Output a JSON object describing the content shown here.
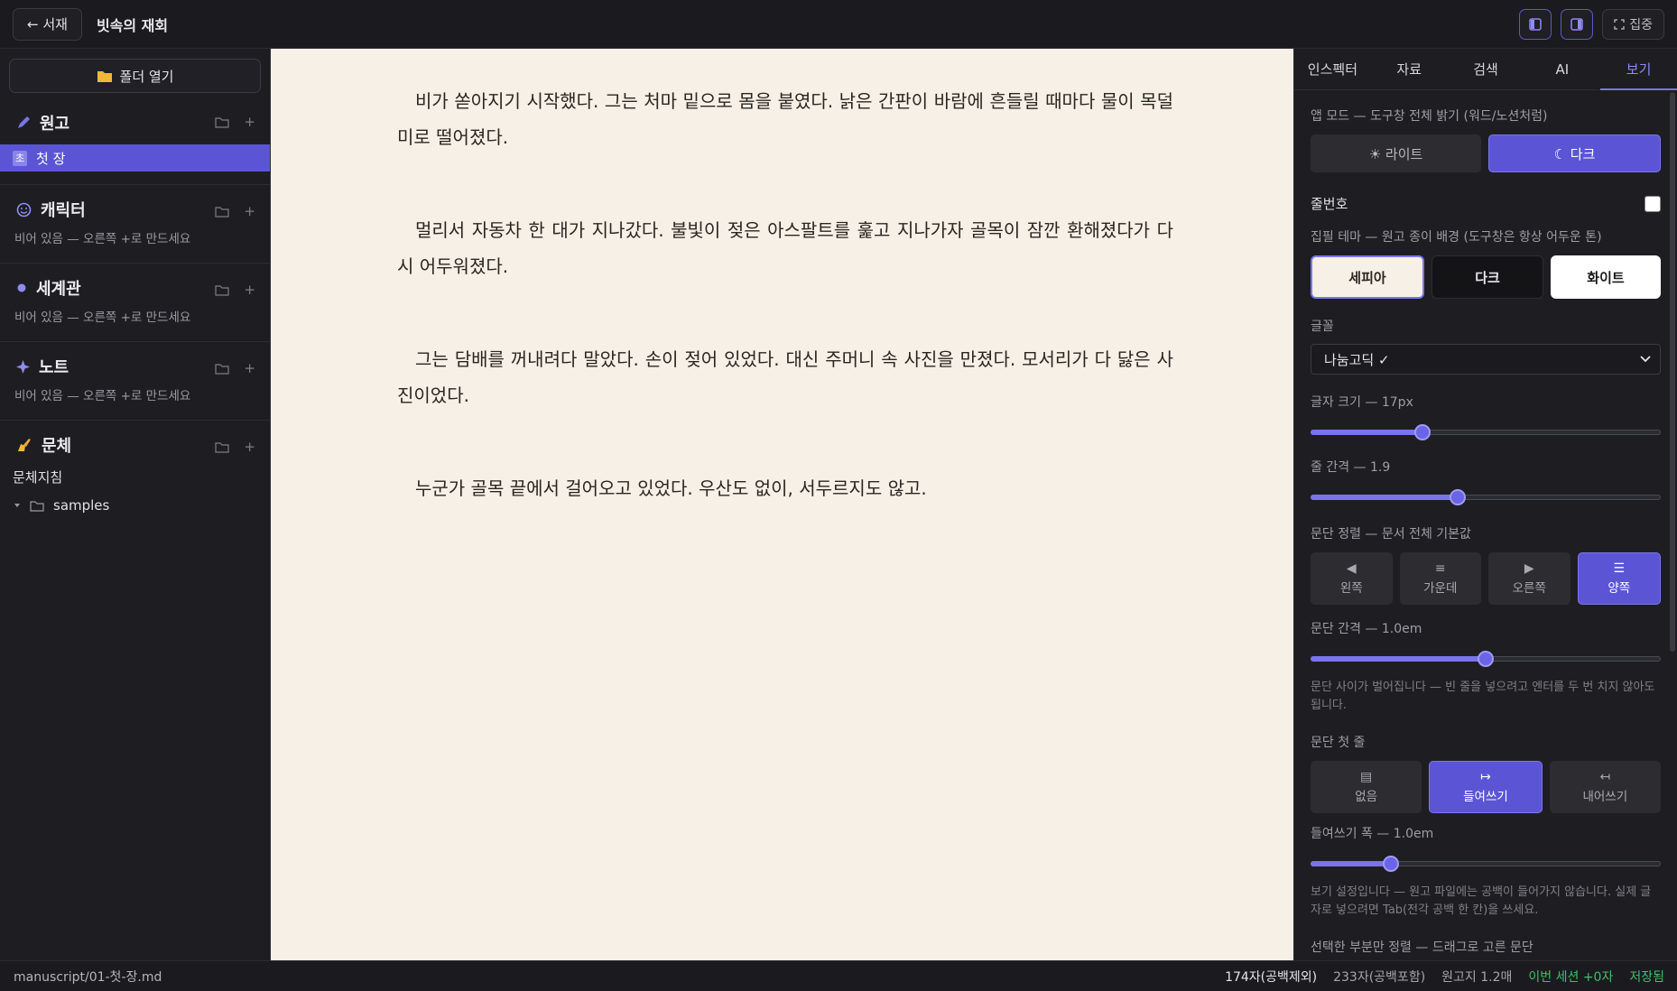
{
  "topbar": {
    "back_label": "← 서재",
    "title": "빗속의 재회",
    "focus_label": "집중",
    "icons": [
      "left-panel-icon",
      "right-panel-icon",
      "fullscreen-icon"
    ]
  },
  "sidebar": {
    "open_folder_label": "폴더 열기",
    "manuscript": {
      "title": "원고",
      "icon": "pencil-icon",
      "file_badge": "초",
      "file_label": "첫 장"
    },
    "characters": {
      "title": "캐릭터",
      "icon": "smiley-icon",
      "empty": "비어 있음 — 오른쪽 +로 만드세요"
    },
    "world": {
      "title": "세계관",
      "icon": "dot-icon",
      "empty": "비어 있음 — 오른쪽 +로 만드세요"
    },
    "notes": {
      "title": "노트",
      "icon": "sparkle-icon",
      "empty": "비어 있음 — 오른쪽 +로 만드세요"
    },
    "style": {
      "title": "문체",
      "icon": "writing-hand-icon",
      "guide": "문체지침",
      "folder": "samples"
    },
    "add_symbol": "+"
  },
  "editor": {
    "paragraphs": [
      "비가 쏟아지기 시작했다. 그는 처마 밑으로 몸을 붙였다. 낡은 간판이 바람에 흔들릴 때마다 물이 목덜미로 떨어졌다.",
      "멀리서 자동차 한 대가 지나갔다. 불빛이 젖은 아스팔트를 훑고 지나가자 골목이 잠깐 환해졌다가 다시 어두워졌다.",
      "그는 담배를 꺼내려다 말았다. 손이 젖어 있었다. 대신 주머니 속 사진을 만졌다. 모서리가 다 닳은 사진이었다.",
      "누군가 골목 끝에서 걸어오고 있었다. 우산도 없이, 서두르지도 않고."
    ]
  },
  "panel": {
    "tabs": [
      "인스펙터",
      "자료",
      "검색",
      "AI",
      "보기"
    ],
    "active_tab": "보기",
    "app_mode_label": "앱 모드 — 도구창 전체 밝기 (워드/노션처럼)",
    "app_mode_light": "☀ 라이트",
    "app_mode_dark": "☾ 다크",
    "line_numbers_label": "줄번호",
    "theme_label": "집필 테마 — 원고 종이 배경 (도구창은 항상 어두운 톤)",
    "themes": [
      "세피아",
      "다크",
      "화이트"
    ],
    "font_label": "글꼴",
    "font_value": "나눔고딕 ✓",
    "font_size_label": "글자 크기 — 17px",
    "font_size_value": 0.32,
    "line_height_label": "줄 간격 — 1.9",
    "line_height_value": 0.42,
    "para_align_label": "문단 정렬 — 문서 전체 기본값",
    "align_options": [
      {
        "glyph": "◀",
        "label": "왼쪽"
      },
      {
        "glyph": "≡",
        "label": "가운데"
      },
      {
        "glyph": "▶",
        "label": "오른쪽"
      },
      {
        "glyph": "☰",
        "label": "양쪽"
      }
    ],
    "para_spacing_label": "문단 간격 — 1.0em",
    "para_spacing_value": 0.5,
    "para_spacing_hint": "문단 사이가 벌어집니다 — 빈 줄을 넣으려고 엔터를 두 번 치지 않아도 됩니다.",
    "first_line_label": "문단 첫 줄",
    "first_line_options": [
      {
        "glyph": "▤",
        "label": "없음"
      },
      {
        "glyph": "↦",
        "label": "들여쓰기"
      },
      {
        "glyph": "↤",
        "label": "내어쓰기"
      }
    ],
    "indent_label": "들여쓰기 폭 — 1.0em",
    "indent_value": 0.23,
    "indent_hint": "보기 설정입니다 — 원고 파일에는 공백이 들어가지 않습니다. 실제 글자로 넣으려면 Tab(전각 공백 한 칸)을 쓰세요.",
    "cut_label": "선택한 부분만 정렬 — 드래그로 고른 문단"
  },
  "status": {
    "path": "manuscript/01-첫-장.md",
    "chars_no_space": "174자(공백제외)",
    "chars_with_space": "233자(공백포함)",
    "manuscript_pages": "원고지 1.2매",
    "session": "이번 세션 +0자",
    "saved": "저장됨"
  },
  "colors": {
    "accent": "#5b55d6",
    "paper": "#f6f0e6",
    "saved_green": "#3fbf6a"
  }
}
